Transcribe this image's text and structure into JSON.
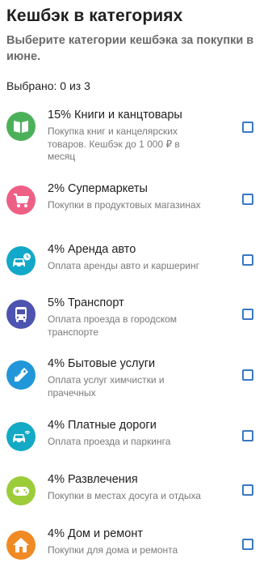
{
  "header": {
    "title": "Кешбэк в категориях",
    "subtitle": "Выберите категории кешбэка за покупки в июне.",
    "selected_count": "Выбрано: 0 из 3"
  },
  "categories": [
    {
      "title": "15% Книги и канцтовары",
      "description": "Покупка книг и канцелярских товаров. Кешбэк до 1 000 ₽ в месяц",
      "icon": "book-icon",
      "color": "#4cb05a",
      "checked": false
    },
    {
      "title": "2% Супермаркеты",
      "description": "Покупки в продуктовых магазинах",
      "icon": "shopping-cart-icon",
      "color": "#ee5f86",
      "checked": false
    },
    {
      "title": "4% Аренда авто",
      "description": "Оплата аренды авто и каршеринг",
      "icon": "car-rental-icon",
      "color": "#12a8c9",
      "checked": false
    },
    {
      "title": "5% Транспорт",
      "description": "Оплата проезда в городском транспорте",
      "icon": "bus-icon",
      "color": "#4c53b0",
      "checked": false
    },
    {
      "title": "4% Бытовые услуги",
      "description": "Оплата услуг химчистки и прачечных",
      "icon": "tag-icon",
      "color": "#2196d8",
      "checked": false
    },
    {
      "title": "4% Платные дороги",
      "description": "Оплата проезда и паркинга",
      "icon": "toll-road-car-icon",
      "color": "#14a9c4",
      "checked": false
    },
    {
      "title": "4% Развлечения",
      "description": "Покупки в местах досуга и отдыха",
      "icon": "gamepad-icon",
      "color": "#9ccc3a",
      "checked": false
    },
    {
      "title": "4% Дом и ремонт",
      "description": "Покупки для дома и ремонта",
      "icon": "house-icon",
      "color": "#f08a24",
      "checked": false
    }
  ],
  "colors": {
    "checkbox_border": "#3a78c2",
    "title_text": "#1f1f1f",
    "secondary_text": "#7a7a7a"
  }
}
